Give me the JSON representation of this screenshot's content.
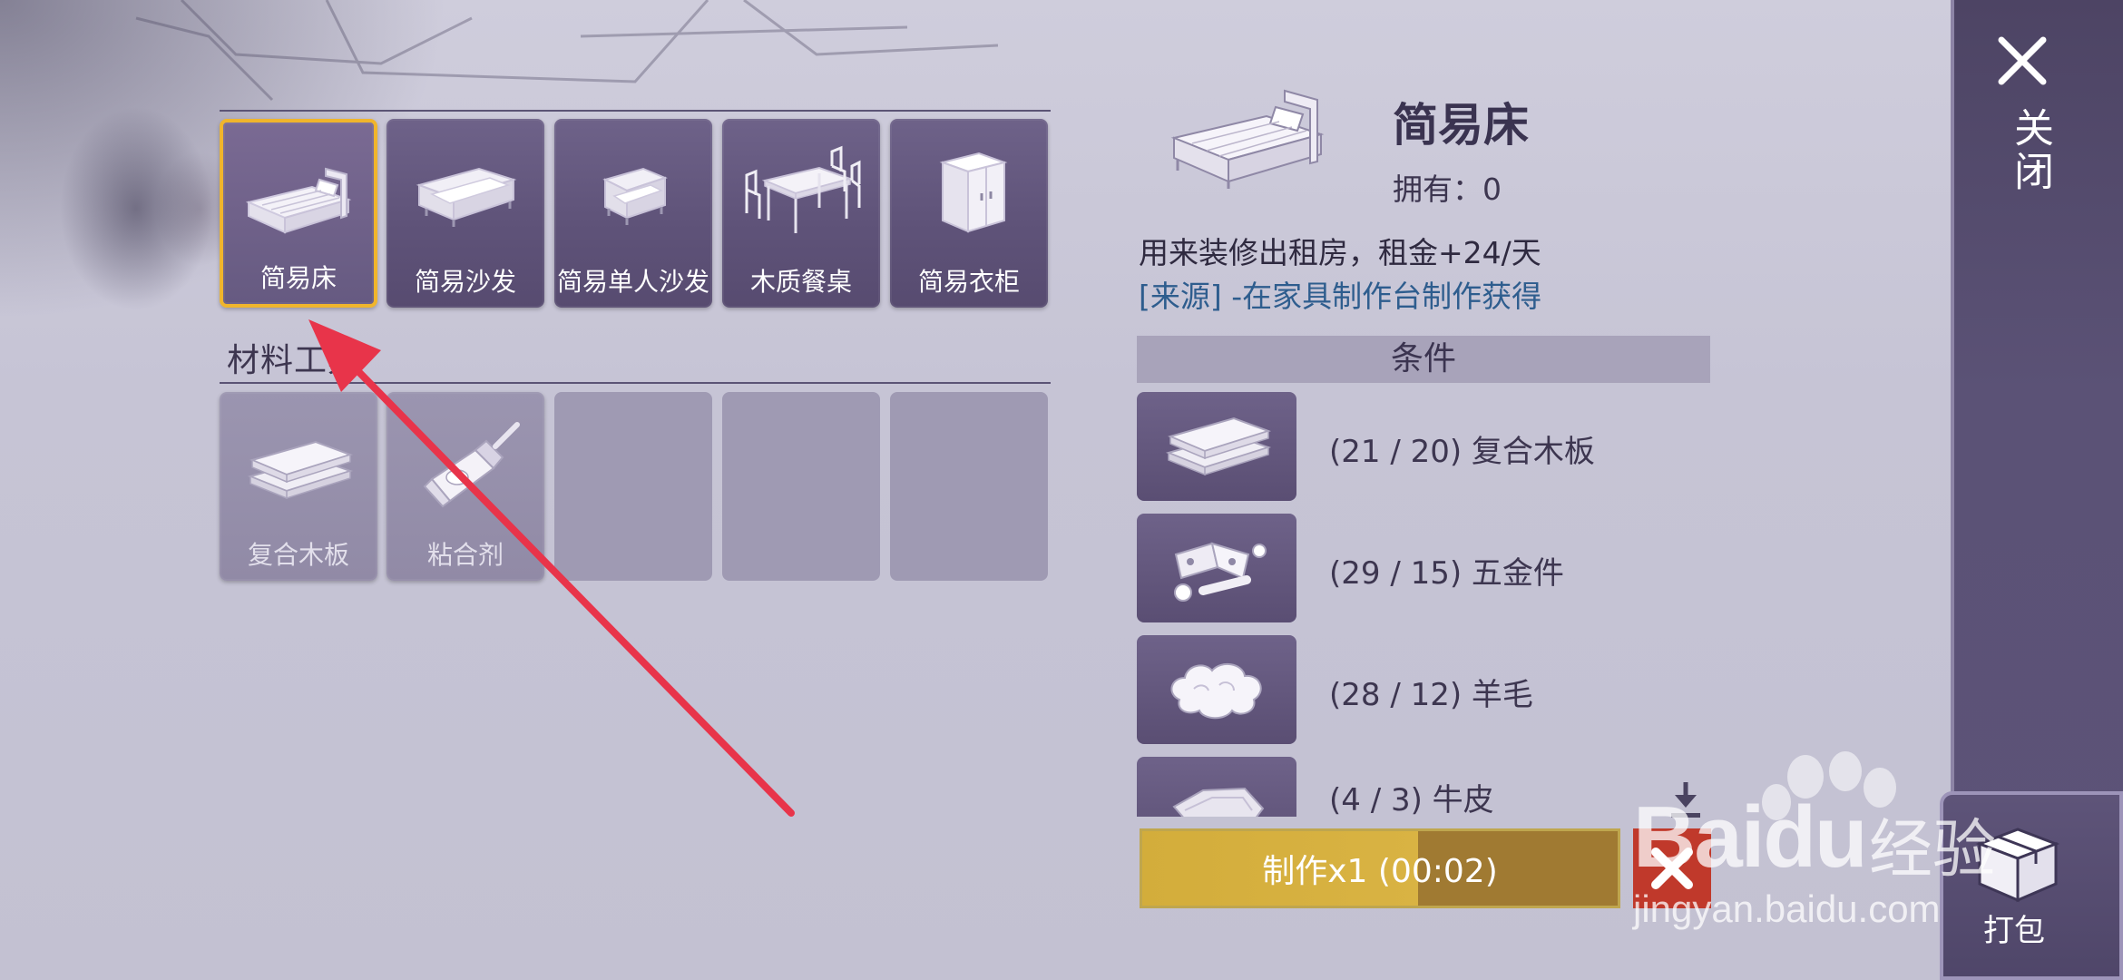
{
  "furniture": {
    "items": [
      {
        "label": "简易床",
        "icon": "bed-icon",
        "selected": true
      },
      {
        "label": "简易沙发",
        "icon": "sofa-icon"
      },
      {
        "label": "简易单人沙发",
        "icon": "armchair-icon"
      },
      {
        "label": "木质餐桌",
        "icon": "dining-table-icon"
      },
      {
        "label": "简易衣柜",
        "icon": "wardrobe-icon"
      }
    ]
  },
  "materials": {
    "title": "材料工具",
    "items": [
      {
        "label": "复合木板",
        "icon": "wood-board-icon"
      },
      {
        "label": "粘合剂",
        "icon": "glue-icon"
      }
    ]
  },
  "detail": {
    "name": "简易床",
    "owned": "拥有：0",
    "description": "用来装修出租房，租金+24/天",
    "source": "[来源] -在家具制作台制作获得",
    "conditions_title": "条件",
    "conditions": [
      {
        "text": "(21 / 20) 复合木板",
        "icon": "wood-board-icon"
      },
      {
        "text": "(29 / 15) 五金件",
        "icon": "hardware-icon"
      },
      {
        "text": "(28 / 12) 羊毛",
        "icon": "wool-icon"
      },
      {
        "text": "(4 / 3) 牛皮",
        "icon": "leather-icon"
      }
    ],
    "craft_label": "制作x1 (00:02)",
    "craft_progress": 0.58
  },
  "side": {
    "close_label": "关闭",
    "pack_label": "打包"
  },
  "watermark": {
    "brand": "Baidu",
    "brand_cn": "经验",
    "url": "jingyan.baidu.com"
  },
  "colors": {
    "selected_border": "#f0b52c",
    "slot_bg": "#6a5e85",
    "craft_button": "#d3ad3b",
    "cancel_button": "#c0392b",
    "source_text": "#2e5d8e",
    "annotation_arrow": "#e8344a"
  }
}
